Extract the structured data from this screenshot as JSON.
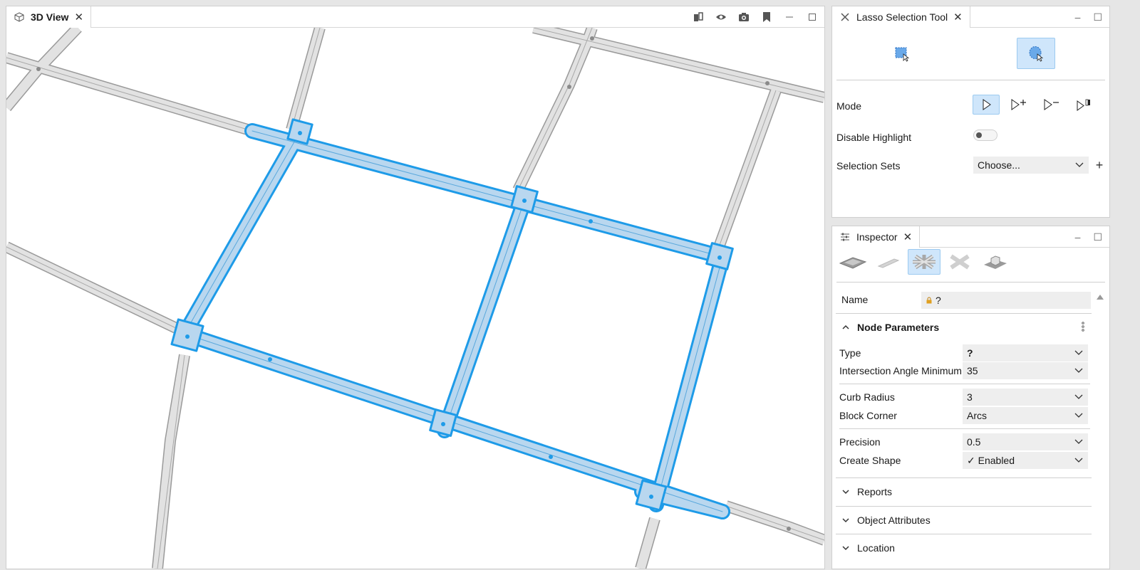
{
  "view": {
    "tab_title": "3D View",
    "toolbar_icons": [
      "layers-icon",
      "eye-icon",
      "camera-icon",
      "bookmark-icon",
      "minimize-icon",
      "maximize-icon"
    ]
  },
  "lasso": {
    "tab_title": "Lasso Selection Tool",
    "mode_label": "Mode",
    "disable_highlight_label": "Disable Highlight",
    "disable_highlight_on": false,
    "selection_sets_label": "Selection Sets",
    "selection_sets_value": "Choose...",
    "add_label": "+"
  },
  "inspector": {
    "tab_title": "Inspector",
    "name_label": "Name",
    "name_value": "?",
    "node_params_title": "Node Parameters",
    "rows": [
      {
        "label": "Type",
        "value": "?"
      },
      {
        "label": "Intersection Angle Minimum",
        "value": "35"
      },
      {
        "label": "Curb Radius",
        "value": "3"
      },
      {
        "label": "Block Corner",
        "value": "Arcs"
      },
      {
        "label": "Precision",
        "value": "0.5"
      },
      {
        "label": "Create Shape",
        "value": "✓ Enabled"
      }
    ],
    "sections": [
      "Reports",
      "Object Attributes",
      "Location"
    ]
  },
  "colors": {
    "selection": "#1e9be8",
    "selection_fill": "#b9d7ef",
    "road_fill": "#e2e2e2",
    "road_edge": "#9a9a9a",
    "active_button": "#cfe6fb"
  }
}
